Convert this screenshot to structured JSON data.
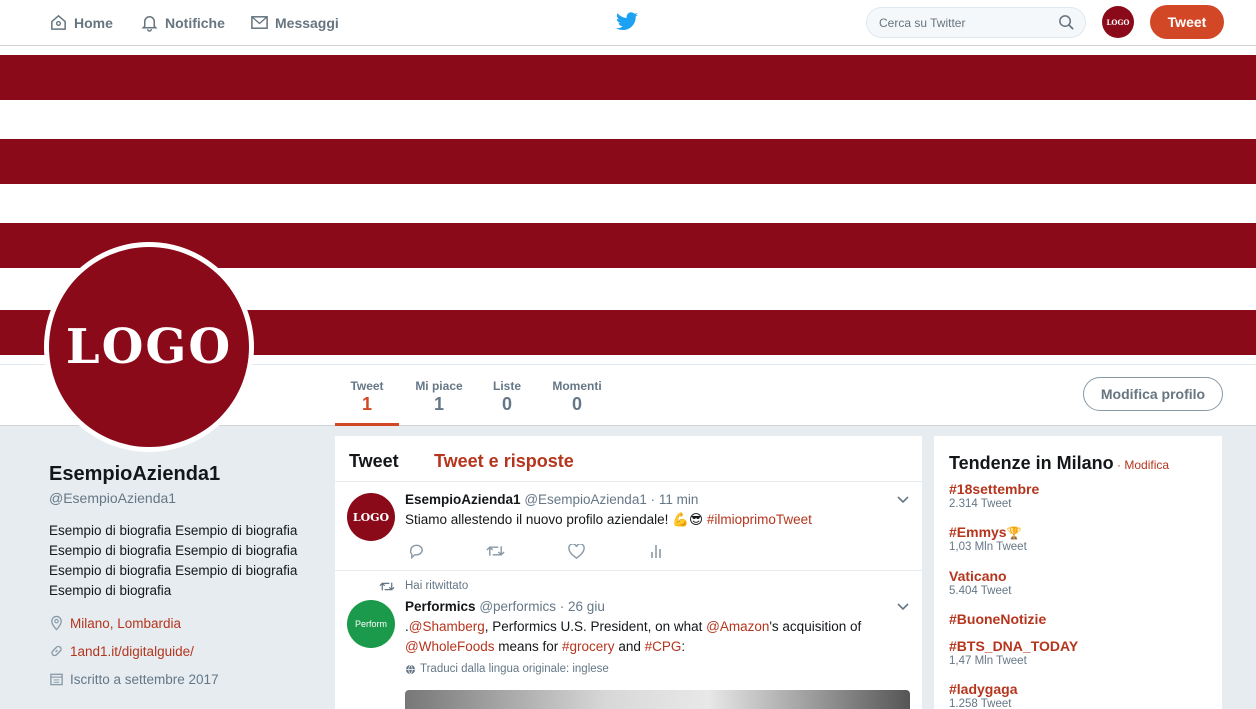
{
  "nav": {
    "home": "Home",
    "notifications": "Notifiche",
    "messages": "Messaggi",
    "search_placeholder": "Cerca su Twitter",
    "avatar_text": "LOGO",
    "tweet_button": "Tweet"
  },
  "colors": {
    "brand": "#8b0a1a",
    "accent": "#d24726",
    "link": "#b5351d",
    "twitter_blue": "#1da1f2"
  },
  "profile": {
    "logo_text": "LOGO",
    "name": "EsempioAzienda1",
    "handle": "@EsempioAzienda1",
    "bio": "Esempio di biografia Esempio di biografia Esempio di biografia Esempio di biografia Esempio di biografia Esempio di biografia Esempio di biografia",
    "location": "Milano, Lombardia",
    "website": "1and1.it/digitalguide/",
    "joined": "Iscritto a settembre 2017",
    "edit_button": "Modifica profilo",
    "stats": [
      {
        "label": "Tweet",
        "value": "1"
      },
      {
        "label": "Mi piace",
        "value": "1"
      },
      {
        "label": "Liste",
        "value": "0"
      },
      {
        "label": "Momenti",
        "value": "0"
      }
    ]
  },
  "timeline": {
    "tabs": [
      "Tweet",
      "Tweet e risposte"
    ],
    "tweet1": {
      "avatar_text": "LOGO",
      "name": "EsempioAzienda1",
      "handle": "@EsempioAzienda1",
      "time": "· 11 min",
      "text": "Stiamo allestendo il nuovo profilo aziendale!",
      "emoji": "💪😎",
      "hashtag": "#ilmioprimoTweet"
    },
    "tweet2": {
      "retweet_label": "Hai ritwittato",
      "avatar_text": "Perform",
      "name": "Performics",
      "handle": "@performics",
      "time": "· 26 giu",
      "pre": ".",
      "mention1": "@Shamberg",
      "text1": ", Performics U.S. President, on what ",
      "mention2": "@Amazon",
      "text2": "'s acquisition of",
      "mention3": "@WholeFoods",
      "text3": " means for ",
      "tag1": "#grocery",
      "text4": " and ",
      "tag2": "#CPG",
      "text5": ":",
      "translate": "Traduci dalla lingua originale: inglese"
    }
  },
  "trends": {
    "title": "Tendenze in Milano",
    "sep": " · ",
    "edit": "Modifica",
    "items": [
      {
        "tag": "#18settembre",
        "count": "2.314 Tweet"
      },
      {
        "tag": "#Emmys",
        "emoji": "🏆",
        "count": "1,03 Mln Tweet"
      },
      {
        "tag": "Vaticano",
        "count": "5.404 Tweet"
      },
      {
        "tag": "#BuoneNotizie",
        "count": ""
      },
      {
        "tag": "#BTS_DNA_TODAY",
        "count": "1,47 Mln Tweet"
      },
      {
        "tag": "#ladygaga",
        "count": "1.258 Tweet"
      }
    ]
  }
}
